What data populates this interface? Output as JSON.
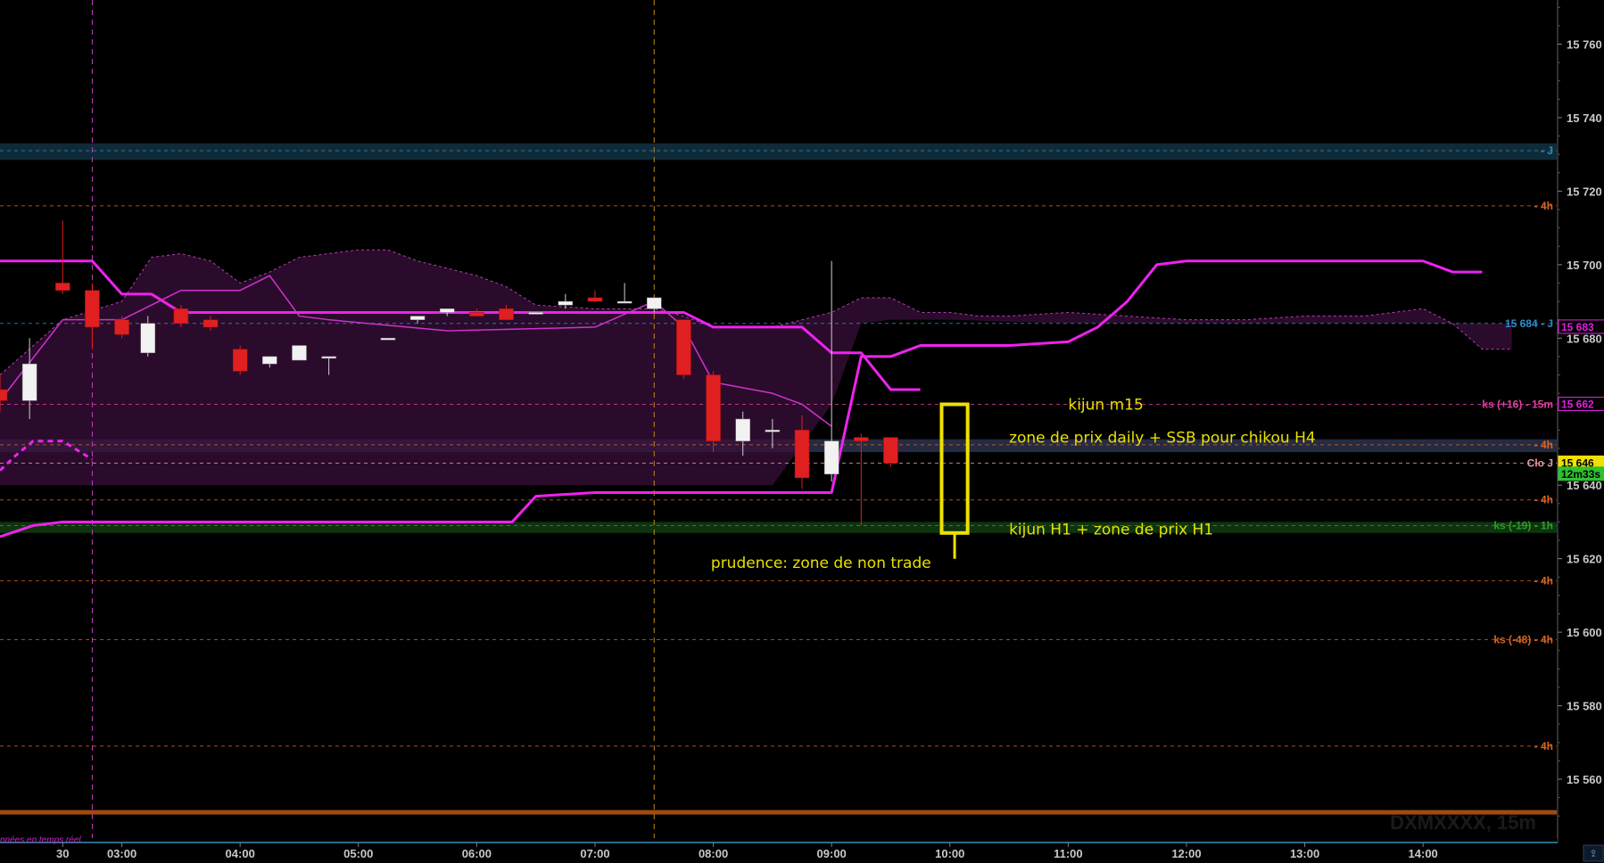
{
  "chart_data": {
    "type": "candlestick",
    "symbol_watermark": "DXMXXXX, 15m",
    "realtime_label": "nnées en temps réel",
    "ylim": [
      15544,
      15772
    ],
    "y_ticks": [
      15760,
      15740,
      15720,
      15700,
      15680,
      15640,
      15620,
      15600,
      15580,
      15560
    ],
    "y_tick_labels": [
      "15 760",
      "15 740",
      "15 720",
      "15 700",
      "15 680",
      "15 640",
      "15 620",
      "15 600",
      "15 580",
      "15 560"
    ],
    "xlim": [
      1.97,
      15.13
    ],
    "x_ticks": [
      {
        "x": 2.5,
        "label": "30"
      },
      {
        "x": 3.0,
        "label": "03:00"
      },
      {
        "x": 4.0,
        "label": "04:00"
      },
      {
        "x": 5.0,
        "label": "05:00"
      },
      {
        "x": 6.0,
        "label": "06:00"
      },
      {
        "x": 7.0,
        "label": "07:00"
      },
      {
        "x": 8.0,
        "label": "08:00"
      },
      {
        "x": 9.0,
        "label": "09:00"
      },
      {
        "x": 10.0,
        "label": "10:00"
      },
      {
        "x": 11.0,
        "label": "11:00"
      },
      {
        "x": 12.0,
        "label": "12:00"
      },
      {
        "x": 13.0,
        "label": "13:00"
      },
      {
        "x": 14.0,
        "label": "14:00"
      }
    ],
    "session_lines": [
      2.75,
      7.5
    ],
    "candles": [
      {
        "t": 1.97,
        "o": 15666,
        "h": 15670,
        "l": 15660,
        "c": 15663
      },
      {
        "t": 2.22,
        "o": 15663,
        "h": 15680,
        "l": 15658,
        "c": 15673
      },
      {
        "t": 2.5,
        "o": 15695,
        "h": 15712,
        "l": 15692,
        "c": 15693
      },
      {
        "t": 2.75,
        "o": 15693,
        "h": 15695,
        "l": 15677,
        "c": 15683
      },
      {
        "t": 3.0,
        "o": 15685,
        "h": 15686,
        "l": 15680,
        "c": 15681
      },
      {
        "t": 3.22,
        "o": 15676,
        "h": 15686,
        "l": 15675,
        "c": 15684
      },
      {
        "t": 3.5,
        "o": 15688,
        "h": 15689,
        "l": 15683,
        "c": 15684
      },
      {
        "t": 3.75,
        "o": 15685,
        "h": 15686,
        "l": 15682,
        "c": 15683
      },
      {
        "t": 4.0,
        "o": 15677,
        "h": 15678,
        "l": 15670,
        "c": 15671
      },
      {
        "t": 4.25,
        "o": 15673,
        "h": 15675,
        "l": 15672,
        "c": 15675
      },
      {
        "t": 4.5,
        "o": 15674,
        "h": 15678,
        "l": 15674,
        "c": 15678
      },
      {
        "t": 4.75,
        "o": 15675,
        "h": 15675,
        "l": 15670,
        "c": 15675
      },
      {
        "t": 5.25,
        "o": 15680,
        "h": 15680,
        "l": 15680,
        "c": 15680
      },
      {
        "t": 5.5,
        "o": 15685,
        "h": 15686,
        "l": 15684,
        "c": 15686
      },
      {
        "t": 5.75,
        "o": 15687,
        "h": 15688,
        "l": 15686,
        "c": 15688
      },
      {
        "t": 6.0,
        "o": 15687,
        "h": 15688,
        "l": 15686,
        "c": 15686
      },
      {
        "t": 6.25,
        "o": 15688,
        "h": 15689,
        "l": 15685,
        "c": 15685
      },
      {
        "t": 6.5,
        "o": 15687,
        "h": 15687,
        "l": 15687,
        "c": 15687
      },
      {
        "t": 6.75,
        "o": 15689,
        "h": 15692,
        "l": 15688,
        "c": 15690
      },
      {
        "t": 7.0,
        "o": 15691,
        "h": 15693,
        "l": 15690,
        "c": 15690
      },
      {
        "t": 7.25,
        "o": 15690,
        "h": 15695,
        "l": 15690,
        "c": 15690
      },
      {
        "t": 7.5,
        "o": 15688,
        "h": 15691,
        "l": 15687,
        "c": 15691
      },
      {
        "t": 7.75,
        "o": 15685,
        "h": 15685,
        "l": 15669,
        "c": 15670
      },
      {
        "t": 8.0,
        "o": 15670,
        "h": 15671,
        "l": 15649,
        "c": 15652
      },
      {
        "t": 8.25,
        "o": 15652,
        "h": 15660,
        "l": 15648,
        "c": 15658
      },
      {
        "t": 8.5,
        "o": 15655,
        "h": 15658,
        "l": 15650,
        "c": 15655
      },
      {
        "t": 8.75,
        "o": 15655,
        "h": 15659,
        "l": 15639,
        "c": 15642
      },
      {
        "t": 9.0,
        "o": 15643,
        "h": 15701,
        "l": 15641,
        "c": 15652
      },
      {
        "t": 9.25,
        "o": 15653,
        "h": 15654,
        "l": 15629,
        "c": 15652
      },
      {
        "t": 9.5,
        "o": 15653,
        "h": 15653,
        "l": 15645,
        "c": 15646
      }
    ],
    "lines": [
      {
        "name": "kijun (épais)",
        "color": "#ee22ee",
        "width": 3,
        "points": [
          [
            1.97,
            15701
          ],
          [
            2.75,
            15701
          ],
          [
            3.0,
            15692
          ],
          [
            3.25,
            15692
          ],
          [
            3.5,
            15687
          ],
          [
            7.75,
            15687
          ],
          [
            8.0,
            15683
          ],
          [
            8.75,
            15683
          ],
          [
            9.0,
            15676
          ],
          [
            9.25,
            15676
          ],
          [
            9.5,
            15666
          ],
          [
            9.75,
            15666
          ]
        ]
      },
      {
        "name": "kijun H1",
        "color": "#ee22ee",
        "width": 3,
        "points": [
          [
            1.97,
            15626
          ],
          [
            2.25,
            15629
          ],
          [
            2.5,
            15630
          ],
          [
            6.0,
            15630
          ],
          [
            6.3,
            15630
          ],
          [
            6.5,
            15637
          ],
          [
            7.0,
            15638
          ],
          [
            9.0,
            15638
          ],
          [
            9.25,
            15675
          ],
          [
            9.5,
            15675
          ],
          [
            9.75,
            15678
          ],
          [
            10.5,
            15678
          ],
          [
            11.0,
            15679
          ],
          [
            11.25,
            15683
          ],
          [
            11.5,
            15690
          ],
          [
            11.75,
            15700
          ],
          [
            12.0,
            15701
          ],
          [
            14.0,
            15701
          ],
          [
            14.25,
            15698
          ],
          [
            14.5,
            15698
          ]
        ]
      },
      {
        "name": "ligne fine",
        "color": "#cc33cc",
        "width": 1.5,
        "points": [
          [
            1.97,
            15663
          ],
          [
            2.5,
            15685
          ],
          [
            3.0,
            15685
          ],
          [
            3.5,
            15693
          ],
          [
            4.0,
            15693
          ],
          [
            4.25,
            15697
          ],
          [
            4.5,
            15686
          ],
          [
            4.75,
            15685
          ],
          [
            5.75,
            15682
          ],
          [
            7.0,
            15683
          ],
          [
            7.5,
            15690
          ],
          [
            7.75,
            15683
          ],
          [
            8.0,
            15668
          ],
          [
            8.5,
            15665
          ],
          [
            8.75,
            15662
          ],
          [
            9.0,
            15656
          ]
        ]
      },
      {
        "name": "chikou",
        "color": "#ee22ee",
        "width": 3,
        "dash": "6,5",
        "points": [
          [
            1.97,
            15644
          ],
          [
            2.1,
            15648
          ],
          [
            2.25,
            15652
          ],
          [
            2.5,
            15652
          ],
          [
            2.75,
            15647
          ]
        ]
      }
    ],
    "cloud": {
      "fill": "#3a0f3a",
      "upper": [
        [
          1.97,
          15670
        ],
        [
          2.5,
          15685
        ],
        [
          3.0,
          15690
        ],
        [
          3.25,
          15702
        ],
        [
          3.5,
          15703
        ],
        [
          3.75,
          15701
        ],
        [
          4.0,
          15695
        ],
        [
          4.25,
          15698
        ],
        [
          4.5,
          15702
        ],
        [
          5.0,
          15704
        ],
        [
          5.25,
          15704
        ],
        [
          5.5,
          15701
        ],
        [
          6.0,
          15697
        ],
        [
          6.25,
          15694
        ],
        [
          6.5,
          15689
        ],
        [
          7.0,
          15688
        ],
        [
          7.5,
          15688
        ],
        [
          7.75,
          15686
        ],
        [
          8.0,
          15683
        ],
        [
          8.5,
          15683
        ],
        [
          9.0,
          15687
        ],
        [
          9.25,
          15691
        ],
        [
          9.5,
          15691
        ],
        [
          9.75,
          15687
        ],
        [
          10.0,
          15687
        ],
        [
          10.25,
          15686
        ],
        [
          10.5,
          15686
        ],
        [
          11.0,
          15687
        ],
        [
          11.5,
          15686
        ],
        [
          12.0,
          15685
        ],
        [
          12.5,
          15685
        ],
        [
          13.0,
          15686
        ],
        [
          13.5,
          15686
        ],
        [
          14.0,
          15688
        ],
        [
          14.25,
          15684
        ],
        [
          14.5,
          15677
        ],
        [
          14.75,
          15677
        ]
      ],
      "lower": [
        [
          1.97,
          15640
        ],
        [
          2.5,
          15640
        ],
        [
          7.0,
          15640
        ],
        [
          8.5,
          15640
        ],
        [
          9.0,
          15662
        ],
        [
          9.25,
          15684
        ],
        [
          9.5,
          15685
        ],
        [
          10.0,
          15685
        ],
        [
          11.0,
          15684
        ],
        [
          11.5,
          15684
        ],
        [
          12.0,
          15684
        ],
        [
          14.0,
          15684
        ],
        [
          14.25,
          15684
        ],
        [
          14.5,
          15684
        ],
        [
          14.75,
          15684
        ]
      ]
    },
    "levels": [
      {
        "y": 15731,
        "label": "- J",
        "color": "#2e8bc9",
        "zone": [
          15728.5,
          15733
        ]
      },
      {
        "y": 15716,
        "label": "- 4h",
        "color": "#d86420"
      },
      {
        "y": 15684,
        "label": "15 684 - J",
        "color": "#2e8bc9"
      },
      {
        "y": 15662,
        "label": "ks (+16) - 15m",
        "color": "#e040a0"
      },
      {
        "y": 15651,
        "label": "- 4h",
        "color": "#d86420",
        "zone": [
          15649,
          15652.5
        ]
      },
      {
        "y": 15646,
        "label": "Clo J",
        "color": "#e09aa0"
      },
      {
        "y": 15636,
        "label": "- 4h",
        "color": "#d86420"
      },
      {
        "y": 15629,
        "label": "ks (-19) - 1h",
        "color": "#2aa02a",
        "zone": [
          15627,
          15630
        ]
      },
      {
        "y": 15614,
        "label": "- 4h",
        "color": "#d86420"
      },
      {
        "y": 15598,
        "label": "ks (-48) - 4h",
        "color": "#d86420"
      },
      {
        "y": 15569,
        "label": "- 4h",
        "color": "#d86420"
      },
      {
        "y": 15551,
        "label": "",
        "color": "#a04a10"
      }
    ],
    "price_badges": [
      {
        "y": 15683,
        "label": "15 683",
        "color": "#e020e0"
      },
      {
        "y": 15662,
        "label": "15 662",
        "color": "#e020e0"
      },
      {
        "y": 15646,
        "label": "15 646",
        "color": "#f0e000"
      },
      {
        "y": 15643,
        "label": "12m33s",
        "color": "#30c030"
      }
    ],
    "annotations": [
      {
        "x": 11.0,
        "y": 15662,
        "text": "kijun m15"
      },
      {
        "x": 10.5,
        "y": 15653,
        "text": "zone de prix daily + SSB pour chikou H4"
      },
      {
        "x": 10.5,
        "y": 15628,
        "text": "kijun H1 + zone de prix H1"
      },
      {
        "x": 7.98,
        "y": 15619,
        "text": "prudence: zone de non trade"
      }
    ],
    "highlight_box": {
      "x0": 9.93,
      "x1": 10.15,
      "y0": 15627,
      "y1": 15662,
      "color": "#f0e000",
      "stem_to": 15619
    }
  }
}
